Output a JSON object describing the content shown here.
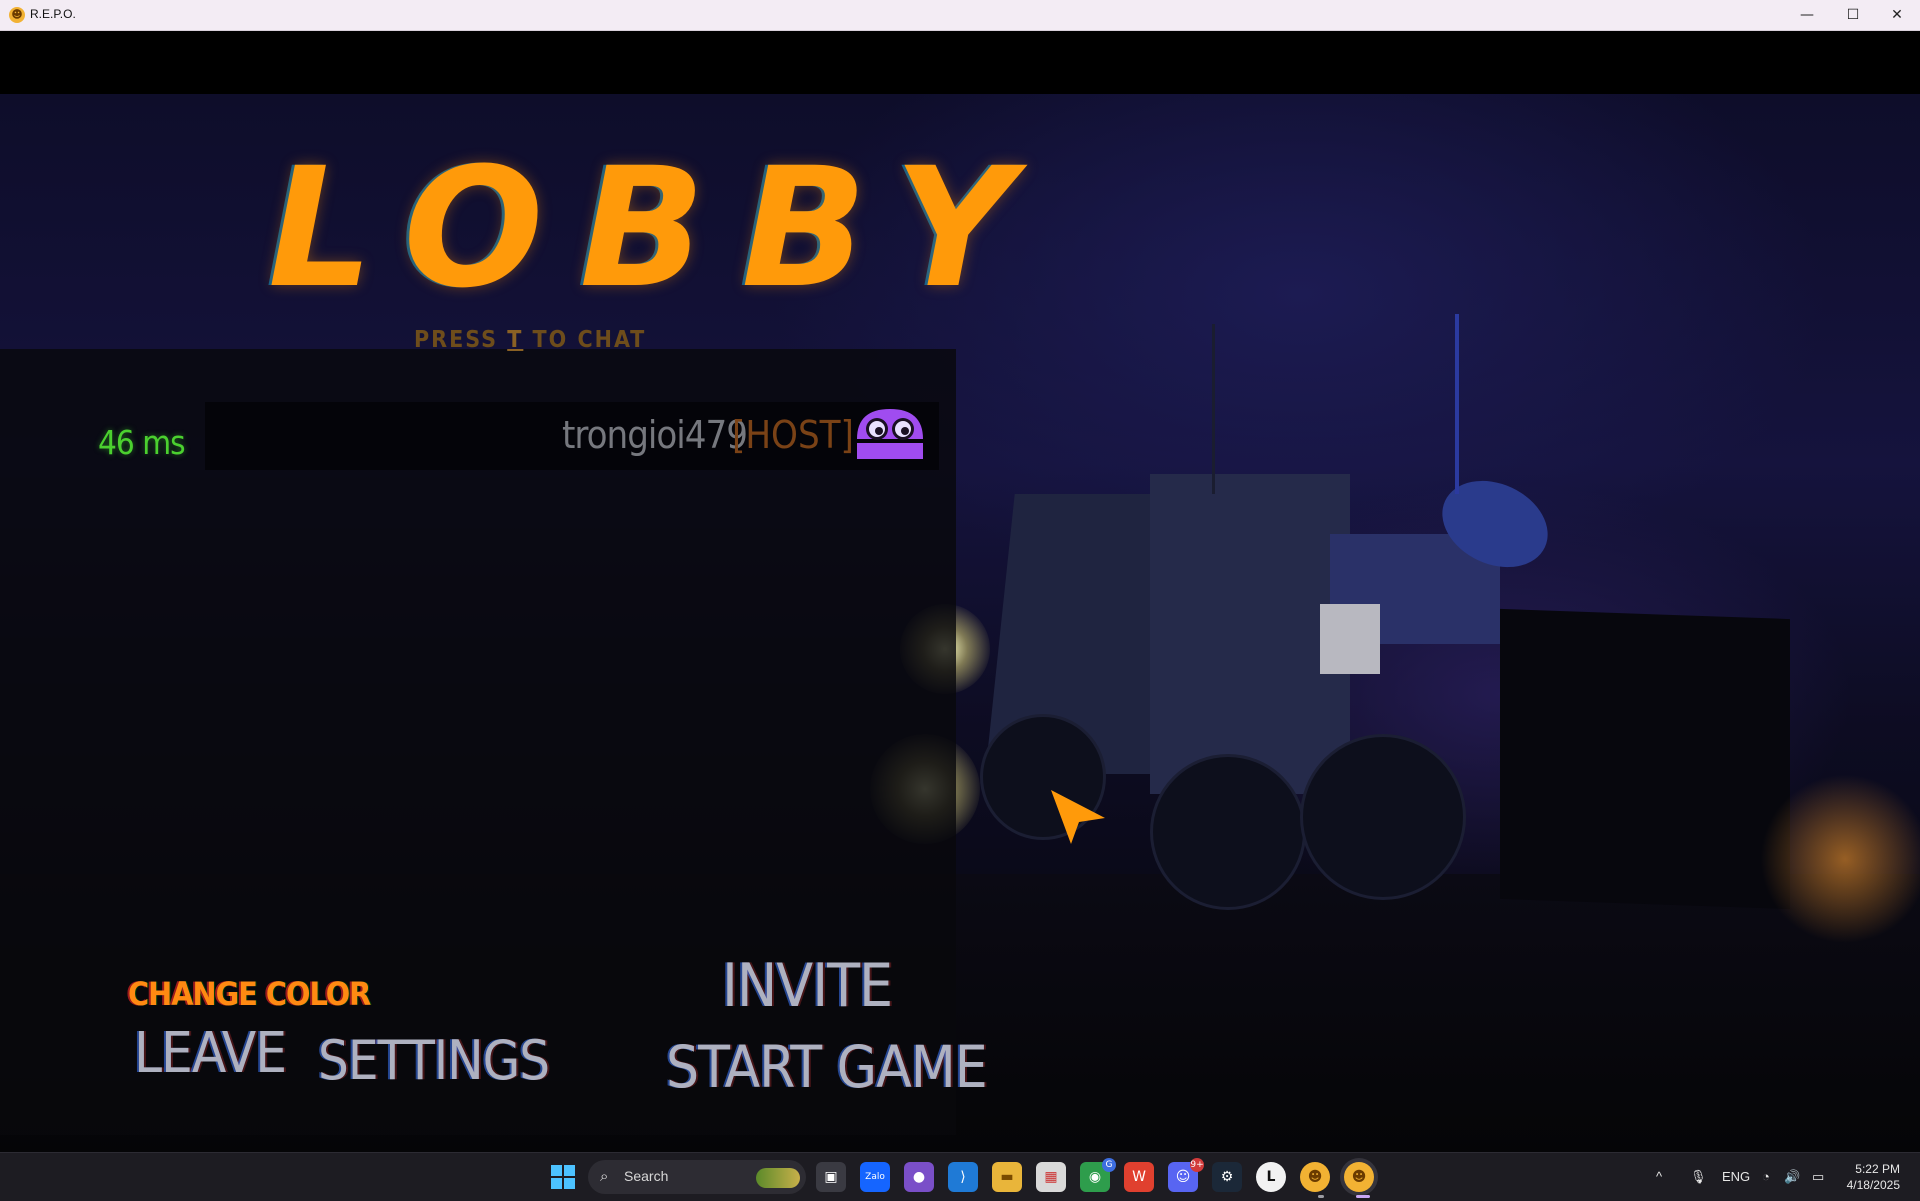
{
  "window": {
    "title": "R.E.P.O.",
    "minimize": "—",
    "maximize": "☐",
    "close": "✕"
  },
  "lobby": {
    "title": "LOBBY",
    "chat_hint_prefix": "PRESS ",
    "chat_hint_key": "T",
    "chat_hint_suffix": " TO CHAT",
    "player": {
      "ping": "46 ms",
      "name": "trongioi479",
      "tag": "[HOST]",
      "avatar_color": "#a04cf0"
    },
    "buttons": {
      "change_color": "CHANGE COLOR",
      "leave": "LEAVE",
      "settings": "SETTINGS",
      "invite": "INVITE",
      "start_game": "START GAME"
    },
    "colors": {
      "accent": "#ff9a0a",
      "ping": "#4bd02f",
      "cursor": "#ff9a0a"
    }
  },
  "taskbar": {
    "search_placeholder": "Search",
    "apps": [
      {
        "name": "task-view",
        "glyph": "▣"
      },
      {
        "name": "zalo",
        "glyph": "Zalo"
      },
      {
        "name": "github",
        "glyph": "●"
      },
      {
        "name": "vscode",
        "glyph": "⟩"
      },
      {
        "name": "file-explorer",
        "glyph": "▬"
      },
      {
        "name": "app-grid",
        "glyph": "▦"
      },
      {
        "name": "chrome",
        "glyph": "◉",
        "badge": "G"
      },
      {
        "name": "wps",
        "glyph": "W"
      },
      {
        "name": "discord",
        "glyph": "☺",
        "badge": "9+"
      },
      {
        "name": "steam",
        "glyph": "⚙"
      },
      {
        "name": "launcher-l",
        "glyph": "L"
      },
      {
        "name": "repo-1",
        "glyph": "☻"
      },
      {
        "name": "repo-2",
        "glyph": "☻"
      }
    ],
    "tray": {
      "chevron": "^",
      "mic": "🎙",
      "language": "ENG",
      "wifi": "◔",
      "volume": "🔊",
      "battery": "▭"
    },
    "time": "5:22 PM",
    "date": "4/18/2025"
  }
}
